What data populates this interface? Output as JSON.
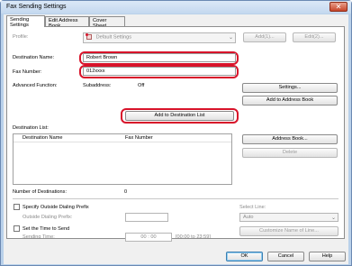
{
  "window": {
    "title": "Fax Sending Settings",
    "close_glyph": "✕"
  },
  "tabs": [
    {
      "label": "Sending Settings"
    },
    {
      "label": "Edit Address Book"
    },
    {
      "label": "Cover Sheet"
    }
  ],
  "profile": {
    "label": "Profile:",
    "value": "Default Settings",
    "add_label": "Add(1)...",
    "edit_label": "Edit(2)..."
  },
  "destination_name": {
    "label": "Destination Name:",
    "value": "Robert Brown"
  },
  "fax_number": {
    "label": "Fax Number:",
    "value": "012xxxx"
  },
  "advanced": {
    "label": "Advanced Function:",
    "subaddress_label": "Subaddress:",
    "subaddress_value": "Off"
  },
  "buttons": {
    "settings": "Settings...",
    "add_to_address_book": "Add to Address Book",
    "add_to_destination_list": "Add to Destination List",
    "address_book": "Address Book...",
    "delete": "Delete",
    "customize_name_of_line": "Customize Name of Line...",
    "ok": "OK",
    "cancel": "Cancel",
    "help": "Help"
  },
  "destination_list": {
    "label": "Destination List:",
    "columns": [
      "Destination Name",
      "Fax Number"
    ]
  },
  "number_of_destinations": {
    "label": "Number of Destinations:",
    "value": "0"
  },
  "dialing_prefix": {
    "label": "Specify Outside Dialing Prefix",
    "sub_label": "Outside Dialing Prefix:"
  },
  "send_time": {
    "label": "Set the Time to Send",
    "sub_label": "Sending Time:",
    "hour": "00",
    "sep": ":",
    "minute": "00",
    "range": "[00:00 to 23:59]"
  },
  "select_line": {
    "label": "Select Line:",
    "value": "Auto"
  },
  "colors": {
    "highlight_ring": "#d8132a",
    "window_frame": "#b9d1ea"
  }
}
